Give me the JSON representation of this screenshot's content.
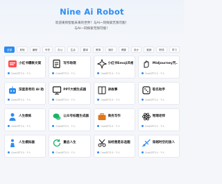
{
  "header": {
    "title": "Nine Ai Robot",
    "line1": "欢迎来到智能未来的世界！与AI一同探索无限可能！",
    "line2": "与AI一同探索无限可能！"
  },
  "tabs": [
    "全部",
    "其他",
    "编程",
    "写作",
    "办公",
    "生活",
    "翻译",
    "教育",
    "娱乐",
    "健康",
    "设计",
    "营销",
    "职场",
    "学习"
  ],
  "cards": [
    {
      "title": "小红书爆款文案",
      "meta": "ChatGPT3.5 · 个人",
      "icon": "xiaohongshu-icon",
      "color": "#ff4d4f"
    },
    {
      "title": "写作助理",
      "meta": "ChatGPT3.5 · 个人",
      "icon": "writing-icon",
      "color": "#1a1a1a"
    },
    {
      "title": "小红书Emoji风格...",
      "meta": "ChatGPT3.5 · 个人",
      "icon": "sparkle-icon",
      "color": "#1a1a1a"
    },
    {
      "title": "Midjourney咒...",
      "meta": "ChatGPT3.5 · 个人",
      "icon": "hand-icon",
      "color": "#1a1a1a"
    },
    {
      "title": "深度思考的 AI 助手",
      "meta": "ChatGPT3.5 · 个人",
      "icon": "robot-icon",
      "color": "#2d8cf0"
    },
    {
      "title": "PPT大纲生成器",
      "meta": "ChatGPT3.5 · 个人",
      "icon": "ppt-icon",
      "color": "#1a1a1a"
    },
    {
      "title": "讲故事",
      "meta": "ChatGPT3.5 · 个人",
      "icon": "book-icon",
      "color": "#1a1a1a"
    },
    {
      "title": "取名助手",
      "meta": "ChatGPT3.5 · 个人",
      "icon": "dice-icon",
      "color": "#1a1a1a"
    },
    {
      "title": "人生教练",
      "meta": "ChatGPT3.5 · 个人",
      "icon": "coach-icon",
      "color": "#2d8cf0"
    },
    {
      "title": "公众号标题生成器",
      "meta": "ChatGPT3.5 · 个人",
      "icon": "wechat-icon",
      "color": "#18b566"
    },
    {
      "title": "商务写作",
      "meta": "ChatGPT3.5 · 个人",
      "icon": "briefcase-icon",
      "color": "#e2761b"
    },
    {
      "title": "物理老师",
      "meta": "ChatGPT3.5 · 个人",
      "icon": "atom-icon",
      "color": "#1a1a1a"
    },
    {
      "title": "人生模拟器",
      "meta": "ChatGPT3.5 · 个人",
      "icon": "person-icon",
      "color": "#2d8cf0"
    },
    {
      "title": "重启人生",
      "meta": "ChatGPT3.5 · 个人",
      "icon": "restart-icon",
      "color": "#18b566"
    },
    {
      "title": "拟经营是非选题",
      "meta": "ChatGPT3.5 · 个人",
      "icon": "scissors-icon",
      "color": "#1a1a1a"
    },
    {
      "title": "穿越时空的旅人",
      "meta": "ChatGPT3.5 · 个人",
      "icon": "travel-icon",
      "color": "#2d8cf0"
    }
  ]
}
